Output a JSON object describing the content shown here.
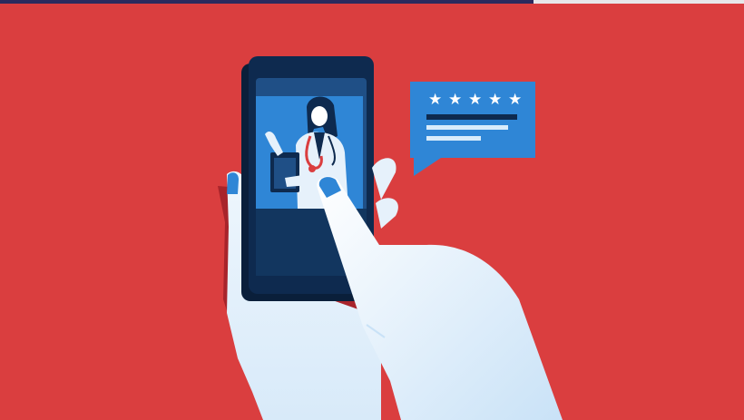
{
  "scene": {
    "description_label": "",
    "rating": {
      "stars_filled": 5,
      "stars_total": 5,
      "star_glyph": "★"
    },
    "colors": {
      "background": "#da3e3f",
      "top_bar_left": "#2b2a5e",
      "top_bar_right": "#e7e7ea",
      "phone_body": "#0e2a4f",
      "phone_screen": "#1f4f86",
      "screen_video_bg": "#2f86d6",
      "bubble": "#2f86d6",
      "bubble_text_dark": "#0e2a4f",
      "bubble_text_light": "#d9ecfb",
      "hand": "#e6f1fb",
      "hand_shadow": "#a8242b",
      "nail": "#2f86d6"
    },
    "icons": {
      "phone": "smartphone-icon",
      "doctor": "doctor-icon",
      "speech_bubble": "speech-bubble-icon",
      "star": "star-icon",
      "hand": "hand-icon"
    }
  }
}
